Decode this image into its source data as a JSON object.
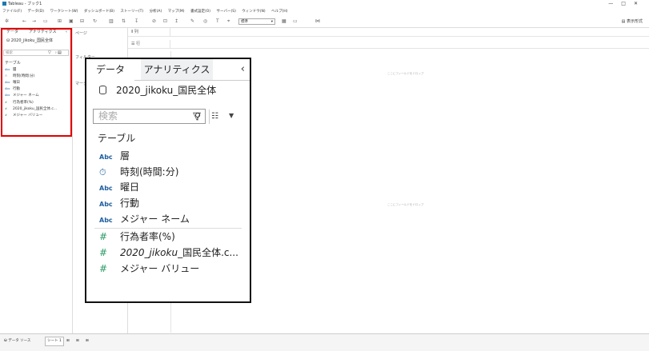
{
  "window": {
    "title": "Tableau - ブック1",
    "controls": [
      "—",
      "□",
      "✕"
    ]
  },
  "menu": [
    "ファイル(F)",
    "データ(D)",
    "ワークシート(W)",
    "ダッシュボード(B)",
    "ストーリー(T)",
    "分析(A)",
    "マップ(M)",
    "書式設定(O)",
    "サーバー(S)",
    "ウィンドウ(N)",
    "ヘルプ(H)"
  ],
  "toolbar": {
    "standard_select": "標準",
    "show_me": "表示形式"
  },
  "small_panel": {
    "tab_data": "データ",
    "tab_analytics": "アナリティクス",
    "datasource": "2020_jikoku_国民全体",
    "search_placeholder": "検索",
    "table_heading": "テーブル",
    "fields": [
      {
        "type": "Abc",
        "name": "層"
      },
      {
        "type": "⏱",
        "name": "時刻(時間:分)"
      },
      {
        "type": "Abc",
        "name": "曜日"
      },
      {
        "type": "Abc",
        "name": "行動"
      },
      {
        "type": "Abc",
        "name": "メジャー ネーム"
      },
      {
        "type": "#",
        "name": "行為者率(%)"
      },
      {
        "type": "#",
        "name": "2020_jikoku_国民全体.c..."
      },
      {
        "type": "#",
        "name": "メジャー バリュー"
      }
    ]
  },
  "pages_label": "ページ",
  "filters_label": "フィルター",
  "marks_label": "マーク",
  "shelves": {
    "columns": "列",
    "rows": "行"
  },
  "canvas": {
    "drop_field_top": "ここにフィールドをドロップ",
    "drop_field_center": "ここにフィールドをドロップ"
  },
  "bottom": {
    "datasource_tab": "データ ソース",
    "sheet_tab": "シート 1"
  },
  "zoom_panel": {
    "tab_data": "データ",
    "tab_analytics": "アナリティクス",
    "collapse": "‹",
    "datasource": "2020_jikoku_国民全体",
    "search_placeholder": "検索",
    "table_heading": "テーブル",
    "dimension_fields": [
      {
        "type": "Abc",
        "name": "層"
      },
      {
        "type": "⏱",
        "name": "時刻(時間:分)"
      },
      {
        "type": "Abc",
        "name": "曜日"
      },
      {
        "type": "Abc",
        "name": "行動"
      },
      {
        "type": "Abc",
        "name": "メジャー ネーム"
      }
    ],
    "measure_fields": [
      {
        "type": "#",
        "name": "行為者率(%)"
      },
      {
        "type": "#",
        "name_italic": "2020_jikoku",
        "name_rest": "_国民全体.c..."
      },
      {
        "type": "#",
        "name": "メジャー バリュー"
      }
    ]
  },
  "colors": {
    "highlight_red": "#e00000",
    "callout_border": "#111111",
    "type_blue": "#1f5f9f",
    "measure_green": "#2a9a66"
  }
}
